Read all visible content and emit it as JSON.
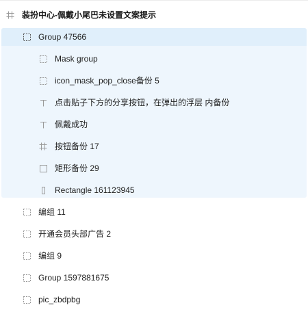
{
  "layers": {
    "root": {
      "label": "装扮中心-佩戴小尾巴未设置文案提示",
      "icon": "frame-hash-icon"
    },
    "items": [
      {
        "label": "Group 47566",
        "icon": "group-dashed-icon",
        "level": 1,
        "selected": true
      },
      {
        "label": "Mask group",
        "icon": "group-dashed-icon",
        "level": 2
      },
      {
        "label": "icon_mask_pop_close备份 5",
        "icon": "group-dashed-icon",
        "level": 2
      },
      {
        "label": "点击贴子下方的分享按钮，在弹出的浮层 内备份",
        "icon": "text-icon",
        "level": 2
      },
      {
        "label": "佩戴成功",
        "icon": "text-icon",
        "level": 2
      },
      {
        "label": "按钮备份 17",
        "icon": "frame-hash-icon",
        "level": 2
      },
      {
        "label": "矩形备份 29",
        "icon": "rectangle-icon",
        "level": 2
      },
      {
        "label": "Rectangle 161123945",
        "icon": "rectangle-narrow-icon",
        "level": 2
      },
      {
        "label": "编组 11",
        "icon": "group-dashed-icon",
        "level": 1
      },
      {
        "label": "开通会员头部广告 2",
        "icon": "group-dashed-icon",
        "level": 1
      },
      {
        "label": "编组 9",
        "icon": "group-dashed-icon",
        "level": 1
      },
      {
        "label": "Group 1597881675",
        "icon": "group-dashed-icon",
        "level": 1
      },
      {
        "label": "pic_zbdpbg",
        "icon": "group-dashed-icon",
        "level": 1
      }
    ]
  },
  "colors": {
    "selection_bg": "#eef6fd",
    "selection_header": "#e0effb",
    "icon_gray": "#9a9a9a",
    "text": "#1f1f1f"
  }
}
